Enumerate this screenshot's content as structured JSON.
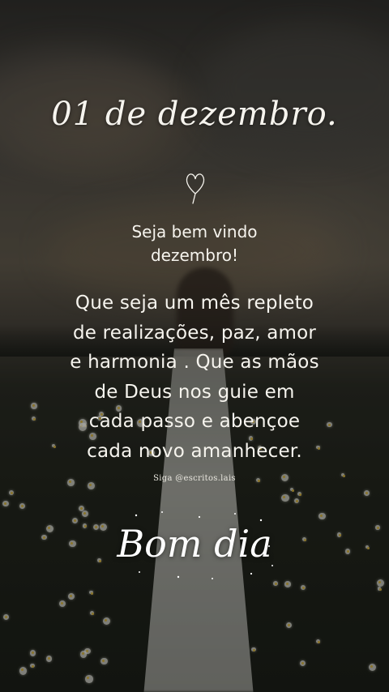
{
  "post": {
    "date": "01 de dezembro.",
    "welcome_lines": [
      "Seja bem vindo",
      "dezembro!"
    ],
    "message_lines": [
      "Que seja um mês repleto",
      "de realizações, paz, amor",
      "e harmonia . Que as mãos",
      "de Deus nos guie em",
      "cada passo e abençoe",
      "cada novo amanhecer."
    ],
    "follow": "Siga @escritos.lais",
    "greeting": "Bom dia"
  },
  "colors": {
    "text": "#f6f4ee",
    "overlay": "#0a0a0a"
  },
  "icons": {
    "divider": "heart-icon"
  }
}
